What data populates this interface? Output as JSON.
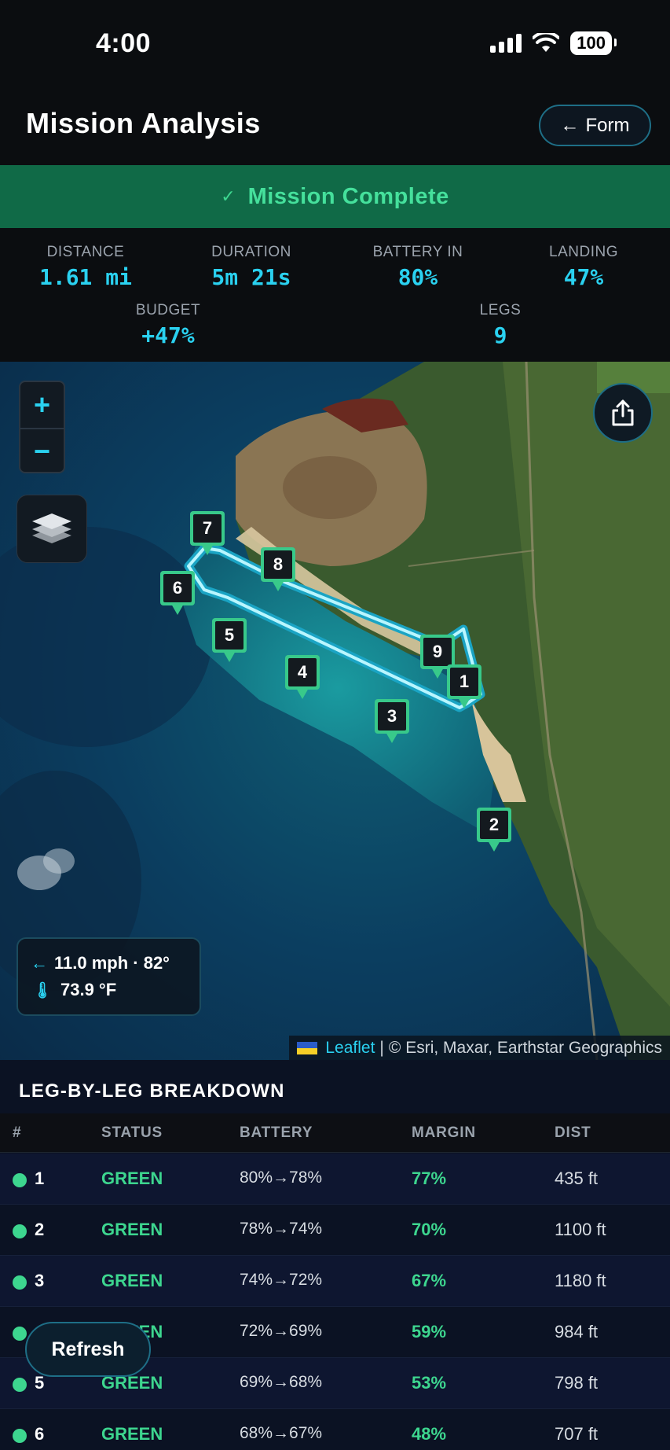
{
  "status_bar": {
    "time": "4:00",
    "battery": "100"
  },
  "header": {
    "title": "Mission Analysis",
    "back_button": "Form"
  },
  "banner": {
    "check": "✓",
    "text": "Mission Complete"
  },
  "stats": {
    "distance": {
      "label": "DISTANCE",
      "value": "1.61 mi"
    },
    "duration": {
      "label": "DURATION",
      "value": "5m 21s"
    },
    "battery_in": {
      "label": "BATTERY IN",
      "value": "80%"
    },
    "landing": {
      "label": "LANDING",
      "value": "47%"
    },
    "budget": {
      "label": "BUDGET",
      "value": "+47%"
    },
    "legs": {
      "label": "LEGS",
      "value": "9"
    }
  },
  "map": {
    "zoom_in": "+",
    "zoom_out": "−",
    "waypoints": [
      "1",
      "2",
      "3",
      "4",
      "5",
      "6",
      "7",
      "8",
      "9"
    ],
    "wind": {
      "arrow": "←",
      "text": "11.0 mph · 82°"
    },
    "temperature": "73.9 °F",
    "attribution": {
      "leaflet": "Leaflet",
      "separator": "|",
      "credits": "© Esri, Maxar, Earthstar Geographics"
    }
  },
  "breakdown": {
    "title": "LEG-BY-LEG BREAKDOWN",
    "columns": {
      "num": "#",
      "status": "STATUS",
      "battery": "BATTERY",
      "margin": "MARGIN",
      "dist": "DIST"
    },
    "rows": [
      {
        "num": "1",
        "status": "GREEN",
        "battery": "80%→78%",
        "margin": "77%",
        "dist": "435 ft"
      },
      {
        "num": "2",
        "status": "GREEN",
        "battery": "78%→74%",
        "margin": "70%",
        "dist": "1100 ft"
      },
      {
        "num": "3",
        "status": "GREEN",
        "battery": "74%→72%",
        "margin": "67%",
        "dist": "1180 ft"
      },
      {
        "num": "4",
        "status": "GREEN",
        "battery": "72%→69%",
        "margin": "59%",
        "dist": "984 ft"
      },
      {
        "num": "5",
        "status": "GREEN",
        "battery": "69%→68%",
        "margin": "53%",
        "dist": "798 ft"
      },
      {
        "num": "6",
        "status": "GREEN",
        "battery": "68%→67%",
        "margin": "48%",
        "dist": "707 ft"
      }
    ]
  },
  "refresh_button": "Refresh",
  "colors": {
    "accent": "#2ad1f0",
    "success": "#3dd68f",
    "banner": "#106a47"
  }
}
